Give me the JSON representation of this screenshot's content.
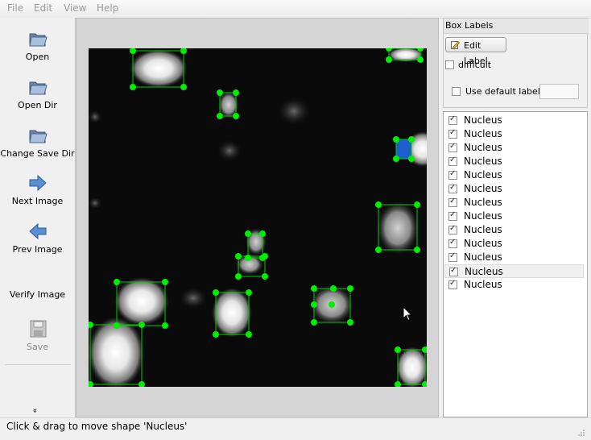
{
  "menu": [
    "File",
    "Edit",
    "View",
    "Help"
  ],
  "toolbar": {
    "items": [
      {
        "label": "Open",
        "icon": "folder-open-icon"
      },
      {
        "label": "Open Dir",
        "icon": "folder-open-icon"
      },
      {
        "label": "Change Save Dir",
        "icon": "folder-open-icon"
      },
      {
        "label": "Next Image",
        "icon": "arrow-right-icon"
      },
      {
        "label": "Prev Image",
        "icon": "arrow-left-icon"
      },
      {
        "label": "Verify Image",
        "icon": ""
      },
      {
        "label": "Save",
        "icon": "floppy-disk-icon",
        "disabled": true
      }
    ],
    "more_indicator": "»"
  },
  "dock": {
    "title": "Box Labels",
    "edit_label": "Edit Label",
    "difficult_label": "difficult",
    "difficult_checked": false,
    "use_default_label": "Use default label",
    "use_default_checked": false,
    "default_label_value": ""
  },
  "labels": [
    {
      "text": "Nucleus",
      "checked": true
    },
    {
      "text": "Nucleus",
      "checked": true
    },
    {
      "text": "Nucleus",
      "checked": true
    },
    {
      "text": "Nucleus",
      "checked": true
    },
    {
      "text": "Nucleus",
      "checked": true
    },
    {
      "text": "Nucleus",
      "checked": true
    },
    {
      "text": "Nucleus",
      "checked": true
    },
    {
      "text": "Nucleus",
      "checked": true
    },
    {
      "text": "Nucleus",
      "checked": true
    },
    {
      "text": "Nucleus",
      "checked": true
    },
    {
      "text": "Nucleus",
      "checked": true
    },
    {
      "text": "Nucleus",
      "checked": true,
      "selected": true
    },
    {
      "text": "Nucleus",
      "checked": true
    }
  ],
  "status": "Click & drag to move shape 'Nucleus'",
  "colors": {
    "box_outline": "#00cc00",
    "handle": "#00ee00",
    "selected_fill": "#1e5fd0",
    "image_bg": "#0a0a0a"
  }
}
